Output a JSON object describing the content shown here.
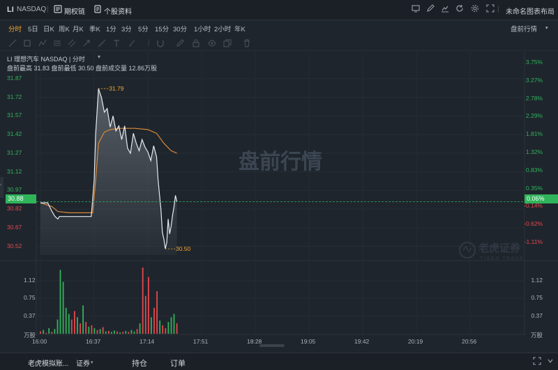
{
  "topbar": {
    "ticker": "LI",
    "exchange": "NASDAQ",
    "options_chain": "期权链",
    "stock_info": "个股资料",
    "layout_name": "未命名图表布局"
  },
  "periods": {
    "items": [
      "分时",
      "5日",
      "日K",
      "周K",
      "月K",
      "季K",
      "1分",
      "3分",
      "5分",
      "15分",
      "30分",
      "1小时",
      "2小时",
      "年K"
    ],
    "active": "分时",
    "session_select": "盘前行情"
  },
  "legend": {
    "title": "LI 理想汽车 NASDAQ | 分时",
    "stats": "盘前最高 31.83 盘前最低 30.50 盘前成交量 12.86万股"
  },
  "watermark": {
    "main": "盘前行情",
    "brand_cn": "老虎证券",
    "brand_en": "TIGER TRADE"
  },
  "price_axis": {
    "labels": [
      "31.87",
      "31.72",
      "31.57",
      "31.42",
      "31.27",
      "31.12",
      "30.97",
      "30.82",
      "30.67",
      "30.52"
    ],
    "current": "30.88"
  },
  "percent_axis": {
    "labels": [
      "3.75%",
      "3.27%",
      "2.78%",
      "2.29%",
      "1.81%",
      "1.32%",
      "0.83%",
      "0.35%",
      "-0.14%",
      "-0.62%",
      "-1.11%"
    ],
    "current": "0.06%"
  },
  "volume_axis": {
    "labels": [
      "1.12",
      "0.75",
      "0.37"
    ],
    "unit": "万股"
  },
  "time_axis": {
    "labels": [
      "16:00",
      "16:37",
      "17:14",
      "17:51",
      "18:28",
      "19:05",
      "19:42",
      "20:19",
      "20:56"
    ]
  },
  "annotations": {
    "high": "31.79",
    "low": "30.50"
  },
  "bottombar": {
    "account": "老虎模拟账...",
    "market": "证券",
    "positions": "持仓",
    "orders": "订单"
  },
  "colors": {
    "up": "#2fb45a",
    "down": "#e5484d",
    "price_line": "#e8ecf0",
    "avg_line": "#d88a3a",
    "current_tag": "#2fb45a",
    "highlight": "#f0a830"
  },
  "chart_data": {
    "type": "line",
    "title": "LI 理想汽车 NASDAQ | 分时",
    "x_range": [
      "16:00",
      "21:15"
    ],
    "ylim": [
      30.45,
      31.92
    ],
    "series": [
      {
        "kind": "price",
        "points": [
          [
            "16:00",
            30.87
          ],
          [
            "16:05",
            30.87
          ],
          [
            "16:08",
            30.8
          ],
          [
            "16:10",
            30.76
          ],
          [
            "16:12",
            30.74
          ],
          [
            "16:13",
            30.76
          ],
          [
            "16:15",
            30.76
          ],
          [
            "16:20",
            30.76
          ],
          [
            "16:25",
            30.76
          ],
          [
            "16:30",
            30.76
          ],
          [
            "16:35",
            30.76
          ],
          [
            "16:37",
            31.05
          ],
          [
            "16:38",
            31.42
          ],
          [
            "16:40",
            31.79
          ],
          [
            "16:42",
            31.72
          ],
          [
            "16:44",
            31.6
          ],
          [
            "16:46",
            31.63
          ],
          [
            "16:48",
            31.48
          ],
          [
            "16:50",
            31.57
          ],
          [
            "16:52",
            31.45
          ],
          [
            "16:54",
            31.49
          ],
          [
            "16:56",
            31.38
          ],
          [
            "16:58",
            31.49
          ],
          [
            "17:00",
            31.31
          ],
          [
            "17:02",
            31.27
          ],
          [
            "17:04",
            31.43
          ],
          [
            "17:06",
            31.35
          ],
          [
            "17:08",
            31.29
          ],
          [
            "17:10",
            31.38
          ],
          [
            "17:12",
            31.32
          ],
          [
            "17:14",
            31.28
          ],
          [
            "17:16",
            31.21
          ],
          [
            "17:18",
            31.33
          ],
          [
            "17:20",
            31.24
          ],
          [
            "17:21",
            31.06
          ],
          [
            "17:22",
            30.94
          ],
          [
            "17:23",
            30.82
          ],
          [
            "17:24",
            30.63
          ],
          [
            "17:25",
            30.58
          ],
          [
            "17:26",
            30.5
          ],
          [
            "17:27",
            30.55
          ],
          [
            "17:28",
            30.74
          ],
          [
            "17:29",
            30.62
          ],
          [
            "17:30",
            30.68
          ],
          [
            "17:31",
            30.77
          ],
          [
            "17:32",
            30.84
          ],
          [
            "17:33",
            30.93
          ],
          [
            "17:34",
            30.88
          ]
        ]
      },
      {
        "kind": "average",
        "points": [
          [
            "16:00",
            30.87
          ],
          [
            "16:08",
            30.84
          ],
          [
            "16:12",
            30.8
          ],
          [
            "16:20",
            30.79
          ],
          [
            "16:30",
            30.79
          ],
          [
            "16:36",
            30.79
          ],
          [
            "16:38",
            31.05
          ],
          [
            "16:40",
            31.35
          ],
          [
            "16:44",
            31.44
          ],
          [
            "16:48",
            31.46
          ],
          [
            "16:55",
            31.47
          ],
          [
            "17:05",
            31.47
          ],
          [
            "17:14",
            31.46
          ],
          [
            "17:20",
            31.43
          ],
          [
            "17:25",
            31.35
          ],
          [
            "17:30",
            31.29
          ],
          [
            "17:34",
            31.27
          ]
        ]
      }
    ],
    "volume": {
      "unit": "万股",
      "ylim": [
        0,
        1.4
      ],
      "bars": [
        [
          0.05,
          "down"
        ],
        [
          0.08,
          "up"
        ],
        [
          0.02,
          "down"
        ],
        [
          0.12,
          "up"
        ],
        [
          0.04,
          "down"
        ],
        [
          0.1,
          "up"
        ],
        [
          0.3,
          "up"
        ],
        [
          1.35,
          "up"
        ],
        [
          1.1,
          "up"
        ],
        [
          0.55,
          "up"
        ],
        [
          0.42,
          "up"
        ],
        [
          0.3,
          "down"
        ],
        [
          0.48,
          "down"
        ],
        [
          0.35,
          "up"
        ],
        [
          0.22,
          "down"
        ],
        [
          0.6,
          "up"
        ],
        [
          0.25,
          "down"
        ],
        [
          0.15,
          "up"
        ],
        [
          0.18,
          "down"
        ],
        [
          0.12,
          "up"
        ],
        [
          0.08,
          "down"
        ],
        [
          0.1,
          "up"
        ],
        [
          0.14,
          "down"
        ],
        [
          0.05,
          "up"
        ],
        [
          0.06,
          "down"
        ],
        [
          0.04,
          "up"
        ],
        [
          0.07,
          "up"
        ],
        [
          0.05,
          "down"
        ],
        [
          0.03,
          "up"
        ],
        [
          0.04,
          "down"
        ],
        [
          0.06,
          "up"
        ],
        [
          0.04,
          "down"
        ],
        [
          0.08,
          "up"
        ],
        [
          0.05,
          "up"
        ],
        [
          0.1,
          "down"
        ],
        [
          0.22,
          "up"
        ],
        [
          1.4,
          "down"
        ],
        [
          0.8,
          "down"
        ],
        [
          1.2,
          "down"
        ],
        [
          0.35,
          "up"
        ],
        [
          0.55,
          "down"
        ],
        [
          0.9,
          "down"
        ],
        [
          0.28,
          "up"
        ],
        [
          0.18,
          "down"
        ],
        [
          0.12,
          "down"
        ],
        [
          0.25,
          "up"
        ],
        [
          0.35,
          "up"
        ],
        [
          0.42,
          "up"
        ],
        [
          0.22,
          "down"
        ]
      ]
    }
  }
}
